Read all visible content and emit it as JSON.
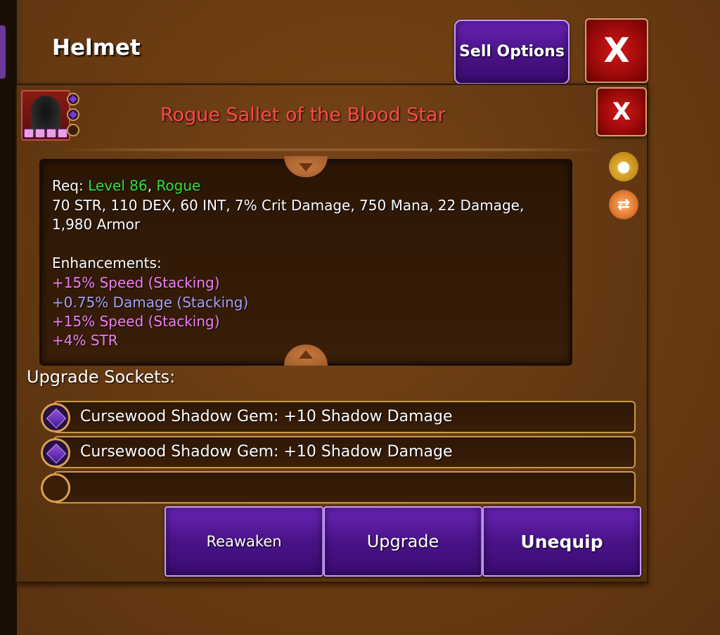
{
  "header": {
    "title": "Helmet",
    "sell_label": "Sell Options",
    "close_label": "X"
  },
  "item": {
    "name": "Rogue Sallet of the Blood Star",
    "close_label": "X",
    "name_color": "#ff4a4a",
    "req_label": "Req:",
    "req_level": "Level 86",
    "req_sep": ",",
    "req_class": "Rogue",
    "stats_line1": "70 STR, 110 DEX, 60 INT, 7% Crit Damage, 750 Mana, 22 Damage,",
    "stats_line2": "1,980 Armor",
    "enh_title": "Enhancements:",
    "enhancements": [
      "+15% Speed (Stacking)",
      "+0.75% Damage (Stacking)",
      "+15% Speed (Stacking)",
      "+4% STR"
    ]
  },
  "sockets": {
    "title": "Upgrade Sockets:",
    "slots": [
      "Cursewood Shadow Gem: +10 Shadow Damage",
      "Cursewood Shadow Gem: +10 Shadow Damage",
      ""
    ]
  },
  "actions": {
    "reawaken": "Reawaken",
    "upgrade": "Upgrade",
    "unequip": "Unequip"
  },
  "icons": {
    "bag": "gold-bag-icon",
    "swap": "swap-icon",
    "portrait": "hooded-rogue-icon"
  }
}
